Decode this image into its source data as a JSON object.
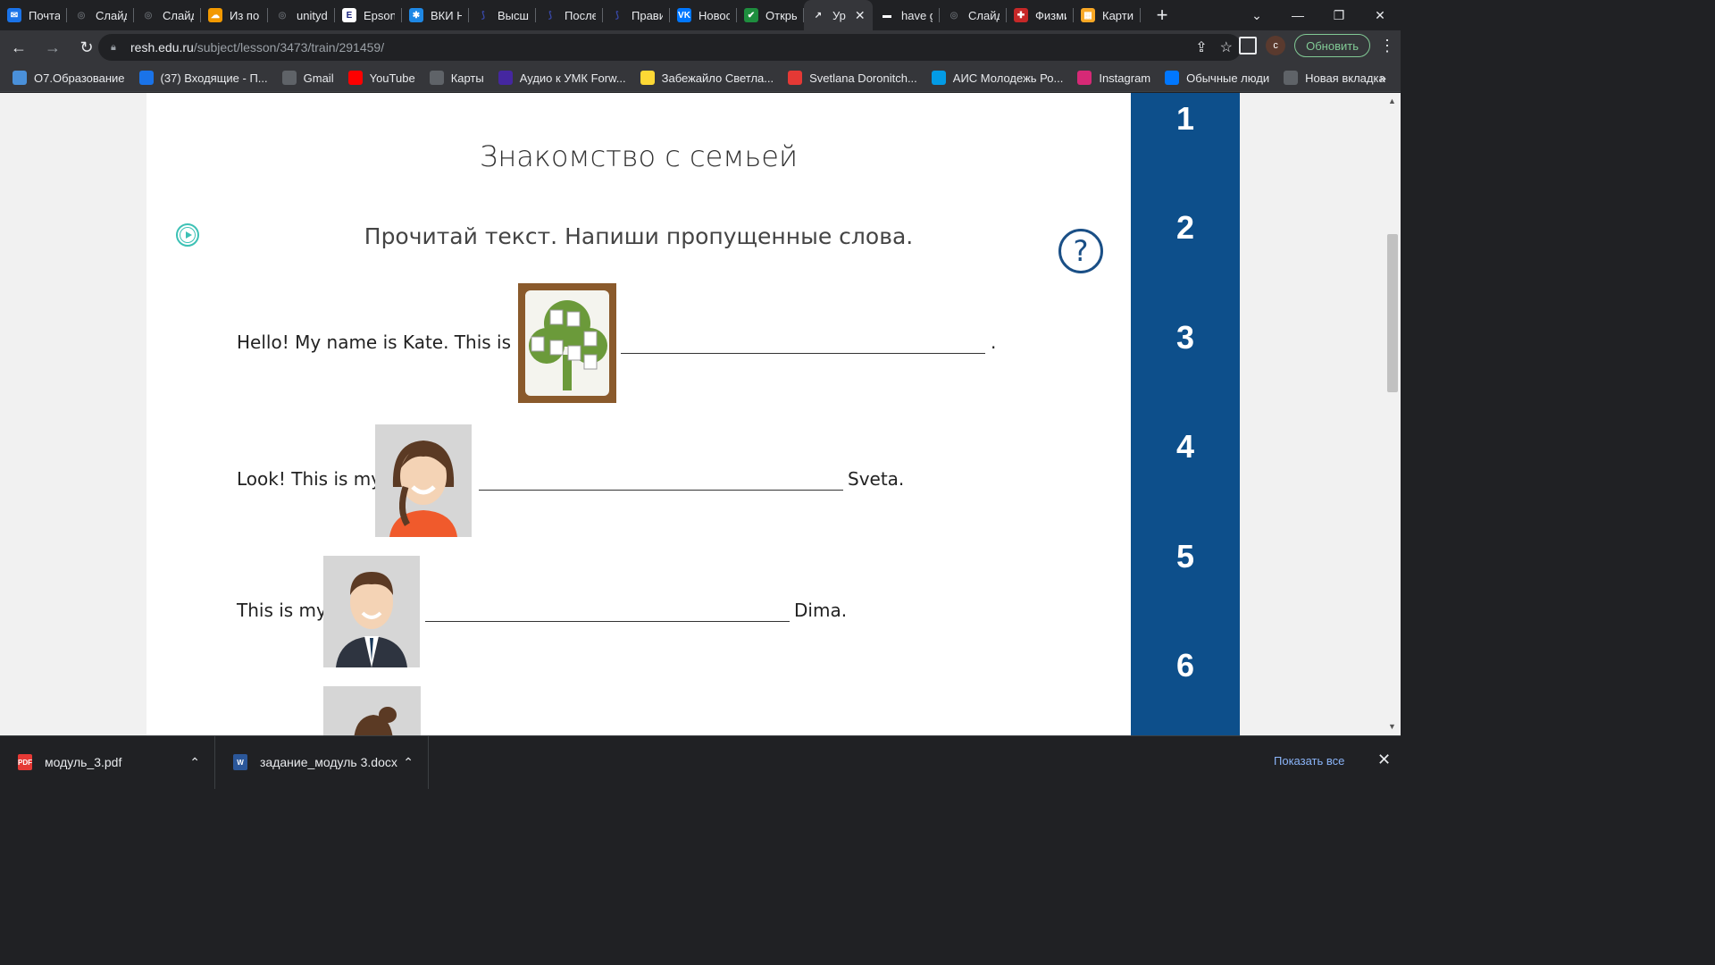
{
  "tabs": [
    {
      "label": "Почта",
      "color": "#1a73e8",
      "glyph": "✉"
    },
    {
      "label": "Слайд",
      "color": "#5f6368",
      "glyph": "◎"
    },
    {
      "label": "Слайд",
      "color": "#5f6368",
      "glyph": "◎"
    },
    {
      "label": "Из по",
      "color": "#f29900",
      "glyph": "☁"
    },
    {
      "label": "unityd",
      "color": "#5f6368",
      "glyph": "◎"
    },
    {
      "label": "Epson",
      "color": "#ffffff",
      "glyph": "E"
    },
    {
      "label": "ВКИ Н",
      "color": "#1e88e5",
      "glyph": "✱"
    },
    {
      "label": "Высш",
      "color": "#3949ab",
      "glyph": "⟆"
    },
    {
      "label": "После",
      "color": "#3949ab",
      "glyph": "⟆"
    },
    {
      "label": "Прави",
      "color": "#3949ab",
      "glyph": "⟆"
    },
    {
      "label": "Новос",
      "color": "#0077ff",
      "glyph": "VK"
    },
    {
      "label": "Откры",
      "color": "#1e8e3e",
      "glyph": "✔"
    },
    {
      "label": "Ур",
      "color": "#e8eaed",
      "glyph": "↗",
      "active": true
    },
    {
      "label": "have g",
      "color": "#ffffff",
      "glyph": "▬"
    },
    {
      "label": "Слайд",
      "color": "#5f6368",
      "glyph": "◎"
    },
    {
      "label": "Физми",
      "color": "#c62828",
      "glyph": "✚"
    },
    {
      "label": "Карти",
      "color": "#f9a825",
      "glyph": "▦"
    }
  ],
  "toolbar": {
    "url_host": "resh.edu.ru",
    "url_path": "/subject/lesson/3473/train/291459/",
    "update_label": "Обновить",
    "avatar_letter": "с"
  },
  "bookmarks": [
    {
      "label": "О7.Образование",
      "color": "#4a90d9"
    },
    {
      "label": "(37) Входящие - П...",
      "color": "#1a73e8"
    },
    {
      "label": "Gmail",
      "color": "#5f6368"
    },
    {
      "label": "YouTube",
      "color": "#ff0000"
    },
    {
      "label": "Карты",
      "color": "#5f6368"
    },
    {
      "label": "Аудио к УМК Forw...",
      "color": "#4527a0"
    },
    {
      "label": "Забежайло Светла...",
      "color": "#fdd835"
    },
    {
      "label": "Svetlana Doronitch...",
      "color": "#e53935"
    },
    {
      "label": "АИС Молодежь Ро...",
      "color": "#039be5"
    },
    {
      "label": "Instagram",
      "color": "#d62976"
    },
    {
      "label": "Обычные люди",
      "color": "#0077ff"
    },
    {
      "label": "Новая вкладка",
      "color": "#5f6368"
    }
  ],
  "lesson": {
    "title": "Знакомство с семьей",
    "instruction": "Прочитай текст. Напиши пропущенные слова.",
    "help_symbol": "?",
    "sentences": [
      {
        "before": "Hello! My name is Kate. This is my",
        "after": "."
      },
      {
        "before": "Look! This is my",
        "after": "Sveta."
      },
      {
        "before": "This is my",
        "after": "Dima."
      }
    ]
  },
  "steps": [
    "1",
    "2",
    "3",
    "4",
    "5",
    "6"
  ],
  "downloads": {
    "items": [
      {
        "name": "модуль_3.pdf",
        "type": "pdf"
      },
      {
        "name": "задание_модуль 3.docx",
        "type": "docx"
      }
    ],
    "show_all": "Показать все"
  },
  "colors": {
    "sidebar": "#0d4f8b",
    "audio_accent": "#3cc1b5",
    "help_accent": "#1a4f86",
    "update_green": "#81c995"
  }
}
